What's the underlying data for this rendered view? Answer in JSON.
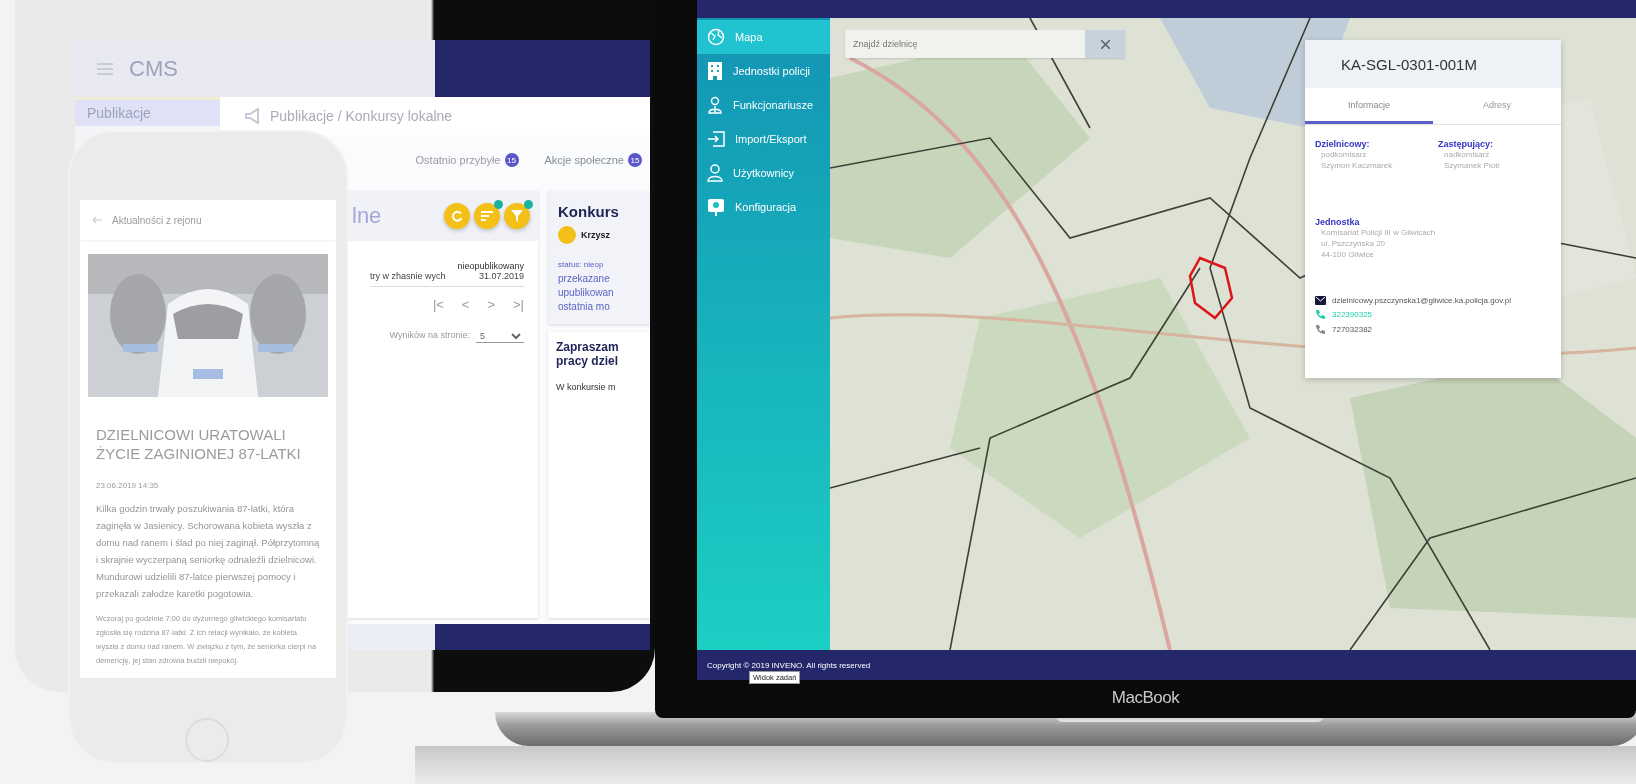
{
  "tablet": {
    "app_title": "CMS",
    "sidebar_items": [
      {
        "label": "Publikacje",
        "selected": true
      }
    ],
    "breadcrumb": "Publikacje / Konkursy lokalne",
    "tabs": [
      {
        "label": "Ostatnio przybyłe",
        "count": "15"
      },
      {
        "label": "Akcje społeczne",
        "count": "15"
      }
    ],
    "list_card": {
      "heading_tail": "lne",
      "status": "nieopublikowany",
      "row_text": "try w zhasnie wych",
      "row_date": "31.07.2019",
      "pager": [
        "|<",
        "<",
        ">",
        ">|"
      ],
      "page_size_label": "Wyników na stronie:",
      "page_size": "5"
    },
    "detail_card": {
      "title": "Konkurs",
      "author": "Krzysz",
      "meta": [
        "status: nieop",
        "przekazane",
        "upublikowan",
        "ostatnia mo"
      ],
      "post_title": "Zapraszam pracy dziel",
      "post_body": "W konkursie m"
    }
  },
  "phone": {
    "header": "Aktualności z rejonu",
    "article": {
      "title": "DZIELNICOWI URATOWALI ŻYCIE ZAGINIONEJ 87-LATKI",
      "date": "23.06.2019 14:35",
      "lead": "Kilka godzin trwały poszukiwania 87-latki, która zaginęła w Jasienicy. Schorowana kobieta wyszła z domu nad ranem i ślad po niej zaginął. Półprzytomną i skrajnie wyczerpaną seniorkę odnaleźli dzielnicowi. Mundurowi udzielili 87-latce pierwszej pomocy i przekazali załodze karetki pogotowia.",
      "body": "Wczoraj po godzinie 7:00 do dyżurnego gliwickiego komisariatu zgłosiła się rodzina 87-latki. Z ich relacji wynikało, że kobieta wyszła z domu nad ranem. W związku z tym, że seniorka cierpi na demencję, jej stan zdrowia budził niepokój."
    }
  },
  "laptop": {
    "sidebar": [
      {
        "label": "Mapa",
        "selected": true
      },
      {
        "label": "Jednostki policji",
        "selected": false
      },
      {
        "label": "Funkcjonariusze",
        "selected": false
      },
      {
        "label": "Import/Eksport",
        "selected": false
      },
      {
        "label": "Użytkownicy",
        "selected": false
      },
      {
        "label": "Konfiguracja",
        "selected": false
      }
    ],
    "search": {
      "placeholder": "Znajdź dzielnicę"
    },
    "district_card": {
      "title": "KA-SGL-0301-001M",
      "tabs": [
        {
          "label": "Informacje",
          "selected": true
        },
        {
          "label": "Adresy",
          "selected": false
        }
      ],
      "people": [
        {
          "heading": "Dzielnicowy:",
          "rank": "podkomisarz",
          "name": "Szymon Kaczmarek"
        },
        {
          "heading": "Zastępujący:",
          "rank": "nadkomisarz",
          "name": "Szymanek Piotr"
        }
      ],
      "unit": {
        "heading": "Jednostka",
        "lines": [
          "Komisariat Policji III w Gliwicach",
          "ul. Pszczyńska 20",
          "44-100 Gliwice"
        ]
      },
      "contacts": [
        {
          "kind": "email",
          "text": "dzielnicowy.pszczynska1@gliwice.ka.policja.gov.pl",
          "highlighted": false
        },
        {
          "kind": "phone",
          "text": "322390325",
          "highlighted": true
        },
        {
          "kind": "phone",
          "text": "727032382",
          "highlighted": false
        }
      ]
    },
    "footer": "Copyright © 2019 INVENO. All rights reserved",
    "tooltip": "Widok zadań",
    "brand": "MacBook"
  }
}
